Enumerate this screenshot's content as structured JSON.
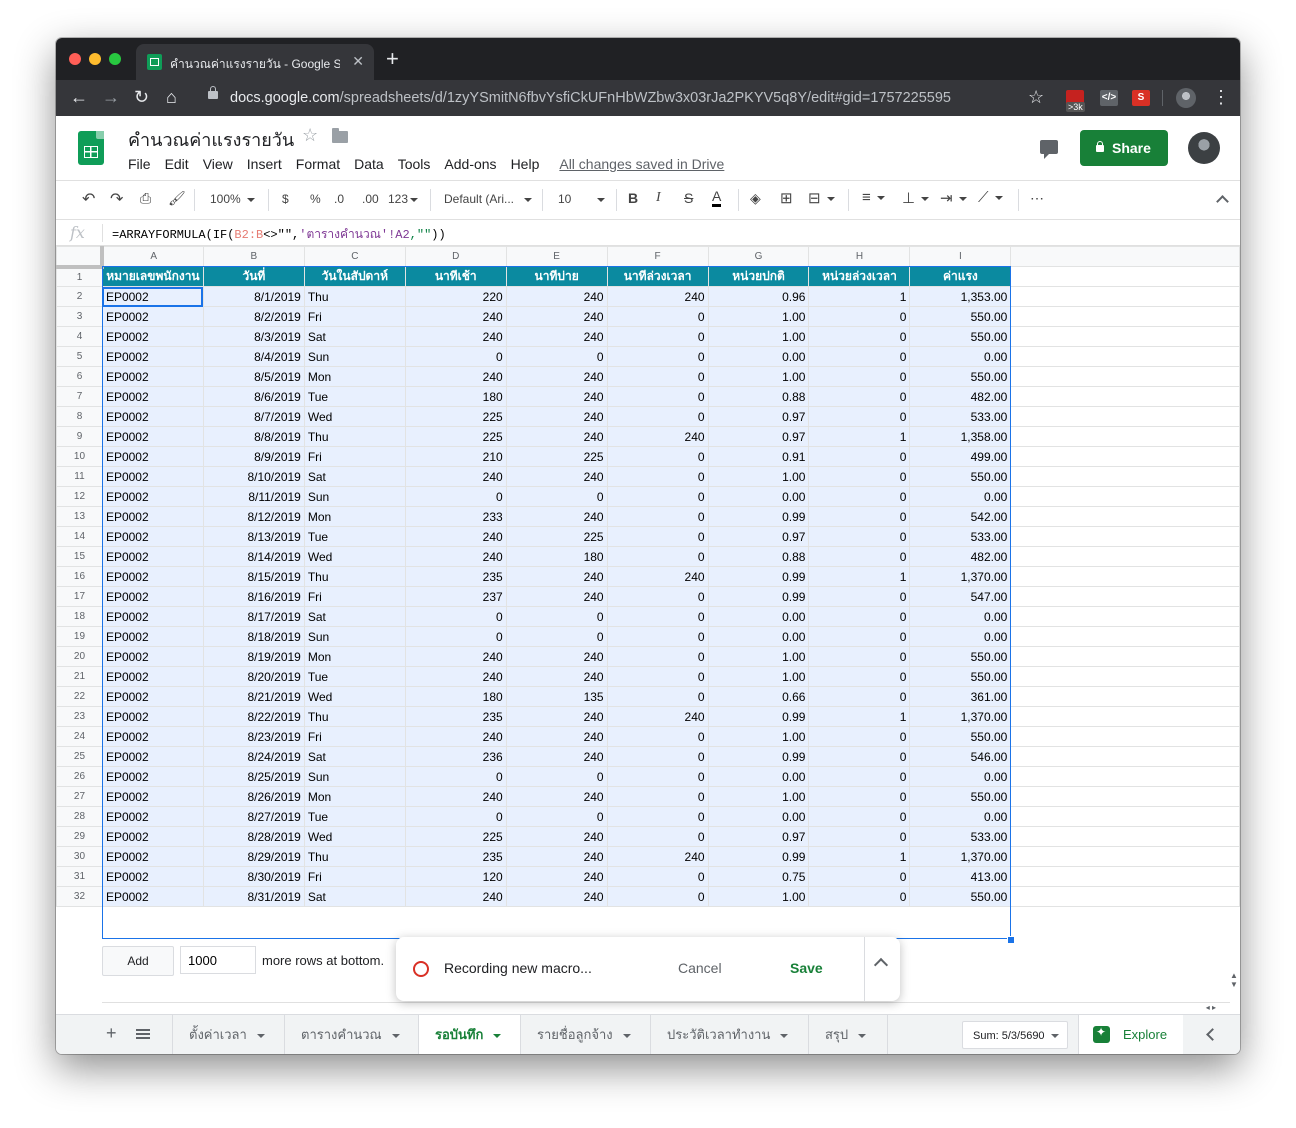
{
  "browser": {
    "tab_title": "คำนวณค่าแรงรายวัน - Google Sh",
    "url_host": "docs.google.com",
    "url_path": "/spreadsheets/d/1zyYSmitN6fbvYsfiCkUFnHbWZbw3x03rJa2PKYV5q8Y/edit#gid=1757225595",
    "ext_badge": ">3k"
  },
  "doc": {
    "title": "คำนวณค่าแรงรายวัน",
    "menu": [
      "File",
      "Edit",
      "View",
      "Insert",
      "Format",
      "Data",
      "Tools",
      "Add-ons",
      "Help"
    ],
    "save_status": "All changes saved in Drive",
    "share_label": "Share"
  },
  "toolbar": {
    "zoom": "100%",
    "currency": "$",
    "percent": "%",
    "dec_less": ".0",
    "dec_more": ".00",
    "more_formats": "123",
    "font": "Default (Ari...",
    "font_size": "10",
    "bold": "B",
    "italic": "I",
    "strike": "S",
    "text_color": "A",
    "more": "⋯"
  },
  "formula": {
    "prefix": "=ARRAYFORMULA(IF(",
    "range": "B2:B",
    "op": "<>\"\",",
    "ref": "'ตารางคำนวณ'!A2",
    "str": ",\"\"",
    "suffix": "))"
  },
  "grid": {
    "columns": [
      "A",
      "B",
      "C",
      "D",
      "E",
      "F",
      "G",
      "H",
      "I"
    ],
    "headers": [
      "หมายเลขพนักงาน",
      "วันที่",
      "วันในสัปดาห์",
      "นาทีเช้า",
      "นาทีบ่าย",
      "นาทีล่วงเวลา",
      "หน่วยปกติ",
      "หน่วยล่วงเวลา",
      "ค่าแรง"
    ],
    "rows": [
      [
        "EP0002",
        "8/1/2019",
        "Thu",
        "220",
        "240",
        "240",
        "0.96",
        "1",
        "1,353.00"
      ],
      [
        "EP0002",
        "8/2/2019",
        "Fri",
        "240",
        "240",
        "0",
        "1.00",
        "0",
        "550.00"
      ],
      [
        "EP0002",
        "8/3/2019",
        "Sat",
        "240",
        "240",
        "0",
        "1.00",
        "0",
        "550.00"
      ],
      [
        "EP0002",
        "8/4/2019",
        "Sun",
        "0",
        "0",
        "0",
        "0.00",
        "0",
        "0.00"
      ],
      [
        "EP0002",
        "8/5/2019",
        "Mon",
        "240",
        "240",
        "0",
        "1.00",
        "0",
        "550.00"
      ],
      [
        "EP0002",
        "8/6/2019",
        "Tue",
        "180",
        "240",
        "0",
        "0.88",
        "0",
        "482.00"
      ],
      [
        "EP0002",
        "8/7/2019",
        "Wed",
        "225",
        "240",
        "0",
        "0.97",
        "0",
        "533.00"
      ],
      [
        "EP0002",
        "8/8/2019",
        "Thu",
        "225",
        "240",
        "240",
        "0.97",
        "1",
        "1,358.00"
      ],
      [
        "EP0002",
        "8/9/2019",
        "Fri",
        "210",
        "225",
        "0",
        "0.91",
        "0",
        "499.00"
      ],
      [
        "EP0002",
        "8/10/2019",
        "Sat",
        "240",
        "240",
        "0",
        "1.00",
        "0",
        "550.00"
      ],
      [
        "EP0002",
        "8/11/2019",
        "Sun",
        "0",
        "0",
        "0",
        "0.00",
        "0",
        "0.00"
      ],
      [
        "EP0002",
        "8/12/2019",
        "Mon",
        "233",
        "240",
        "0",
        "0.99",
        "0",
        "542.00"
      ],
      [
        "EP0002",
        "8/13/2019",
        "Tue",
        "240",
        "225",
        "0",
        "0.97",
        "0",
        "533.00"
      ],
      [
        "EP0002",
        "8/14/2019",
        "Wed",
        "240",
        "180",
        "0",
        "0.88",
        "0",
        "482.00"
      ],
      [
        "EP0002",
        "8/15/2019",
        "Thu",
        "235",
        "240",
        "240",
        "0.99",
        "1",
        "1,370.00"
      ],
      [
        "EP0002",
        "8/16/2019",
        "Fri",
        "237",
        "240",
        "0",
        "0.99",
        "0",
        "547.00"
      ],
      [
        "EP0002",
        "8/17/2019",
        "Sat",
        "0",
        "0",
        "0",
        "0.00",
        "0",
        "0.00"
      ],
      [
        "EP0002",
        "8/18/2019",
        "Sun",
        "0",
        "0",
        "0",
        "0.00",
        "0",
        "0.00"
      ],
      [
        "EP0002",
        "8/19/2019",
        "Mon",
        "240",
        "240",
        "0",
        "1.00",
        "0",
        "550.00"
      ],
      [
        "EP0002",
        "8/20/2019",
        "Tue",
        "240",
        "240",
        "0",
        "1.00",
        "0",
        "550.00"
      ],
      [
        "EP0002",
        "8/21/2019",
        "Wed",
        "180",
        "135",
        "0",
        "0.66",
        "0",
        "361.00"
      ],
      [
        "EP0002",
        "8/22/2019",
        "Thu",
        "235",
        "240",
        "240",
        "0.99",
        "1",
        "1,370.00"
      ],
      [
        "EP0002",
        "8/23/2019",
        "Fri",
        "240",
        "240",
        "0",
        "1.00",
        "0",
        "550.00"
      ],
      [
        "EP0002",
        "8/24/2019",
        "Sat",
        "236",
        "240",
        "0",
        "0.99",
        "0",
        "546.00"
      ],
      [
        "EP0002",
        "8/25/2019",
        "Sun",
        "0",
        "0",
        "0",
        "0.00",
        "0",
        "0.00"
      ],
      [
        "EP0002",
        "8/26/2019",
        "Mon",
        "240",
        "240",
        "0",
        "1.00",
        "0",
        "550.00"
      ],
      [
        "EP0002",
        "8/27/2019",
        "Tue",
        "0",
        "0",
        "0",
        "0.00",
        "0",
        "0.00"
      ],
      [
        "EP0002",
        "8/28/2019",
        "Wed",
        "225",
        "240",
        "0",
        "0.97",
        "0",
        "533.00"
      ],
      [
        "EP0002",
        "8/29/2019",
        "Thu",
        "235",
        "240",
        "240",
        "0.99",
        "1",
        "1,370.00"
      ],
      [
        "EP0002",
        "8/30/2019",
        "Fri",
        "120",
        "240",
        "0",
        "0.75",
        "0",
        "413.00"
      ],
      [
        "EP0002",
        "8/31/2019",
        "Sat",
        "240",
        "240",
        "0",
        "1.00",
        "0",
        "550.00"
      ]
    ],
    "add_label": "Add",
    "add_rows_value": "1000",
    "more_rows_text": "more rows at bottom."
  },
  "macro": {
    "message": "Recording new macro...",
    "cancel": "Cancel",
    "save": "Save"
  },
  "sheets": {
    "tabs": [
      "ตั้งค่าเวลา",
      "ตารางคำนวณ",
      "รอบันทึก",
      "รายชื่อลูกจ้าง",
      "ประวัติเวลาทำงาน",
      "สรุป"
    ],
    "active_index": 2,
    "sum": "Sum: 5/3/5690",
    "explore": "Explore"
  },
  "colors": {
    "header_fill": "#0b8aa0",
    "selection_fill": "#e8f0fe",
    "accent_green": "#188038",
    "record_red": "#d93025"
  }
}
